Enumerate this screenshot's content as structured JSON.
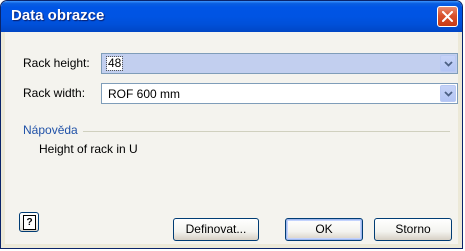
{
  "window": {
    "title": "Data obrazce"
  },
  "fields": {
    "rack_height": {
      "label": "Rack height:",
      "value": "48"
    },
    "rack_width": {
      "label": "Rack width:",
      "value": "ROF 600 mm"
    }
  },
  "help": {
    "heading": "Nápověda",
    "text": "Height of rack in U"
  },
  "buttons": {
    "help_glyph": "?",
    "define": "Definovat...",
    "ok": "OK",
    "cancel": "Storno"
  },
  "colors": {
    "titlebar": "#0054e3",
    "close": "#d9512c",
    "help_heading": "#2152a8",
    "combo_active": "#c2cfef"
  }
}
